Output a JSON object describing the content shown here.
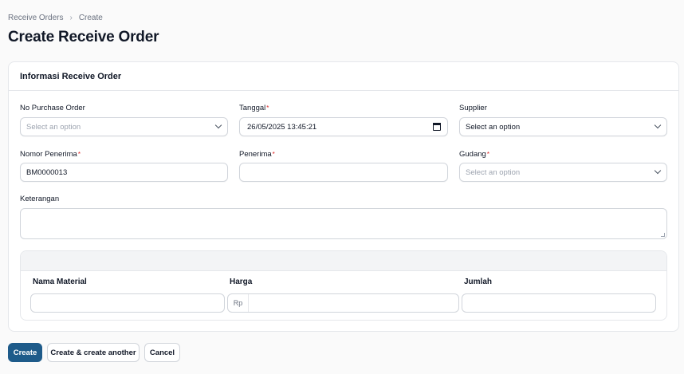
{
  "breadcrumb": {
    "parent": "Receive Orders",
    "current": "Create"
  },
  "page": {
    "title": "Create Receive Order"
  },
  "section": {
    "title": "Informasi Receive Order"
  },
  "fields": {
    "po": {
      "label": "No Purchase Order",
      "placeholder": "Select an option"
    },
    "tanggal": {
      "label": "Tanggal",
      "required": "*",
      "value": "26/05/2025 13:45:21"
    },
    "supplier": {
      "label": "Supplier",
      "value": "Select an option"
    },
    "nomor_penerima": {
      "label": "Nomor Penerima",
      "required": "*",
      "value": "BM0000013"
    },
    "penerima": {
      "label": "Penerima",
      "required": "*",
      "value": ""
    },
    "gudang": {
      "label": "Gudang",
      "required": "*",
      "placeholder": "Select an option"
    },
    "keterangan": {
      "label": "Keterangan",
      "value": ""
    }
  },
  "items": {
    "columns": [
      "Nama Material",
      "Harga",
      "Jumlah"
    ],
    "currency_prefix": "Rp"
  },
  "actions": {
    "create": "Create",
    "create_another": "Create & create another",
    "cancel": "Cancel"
  }
}
